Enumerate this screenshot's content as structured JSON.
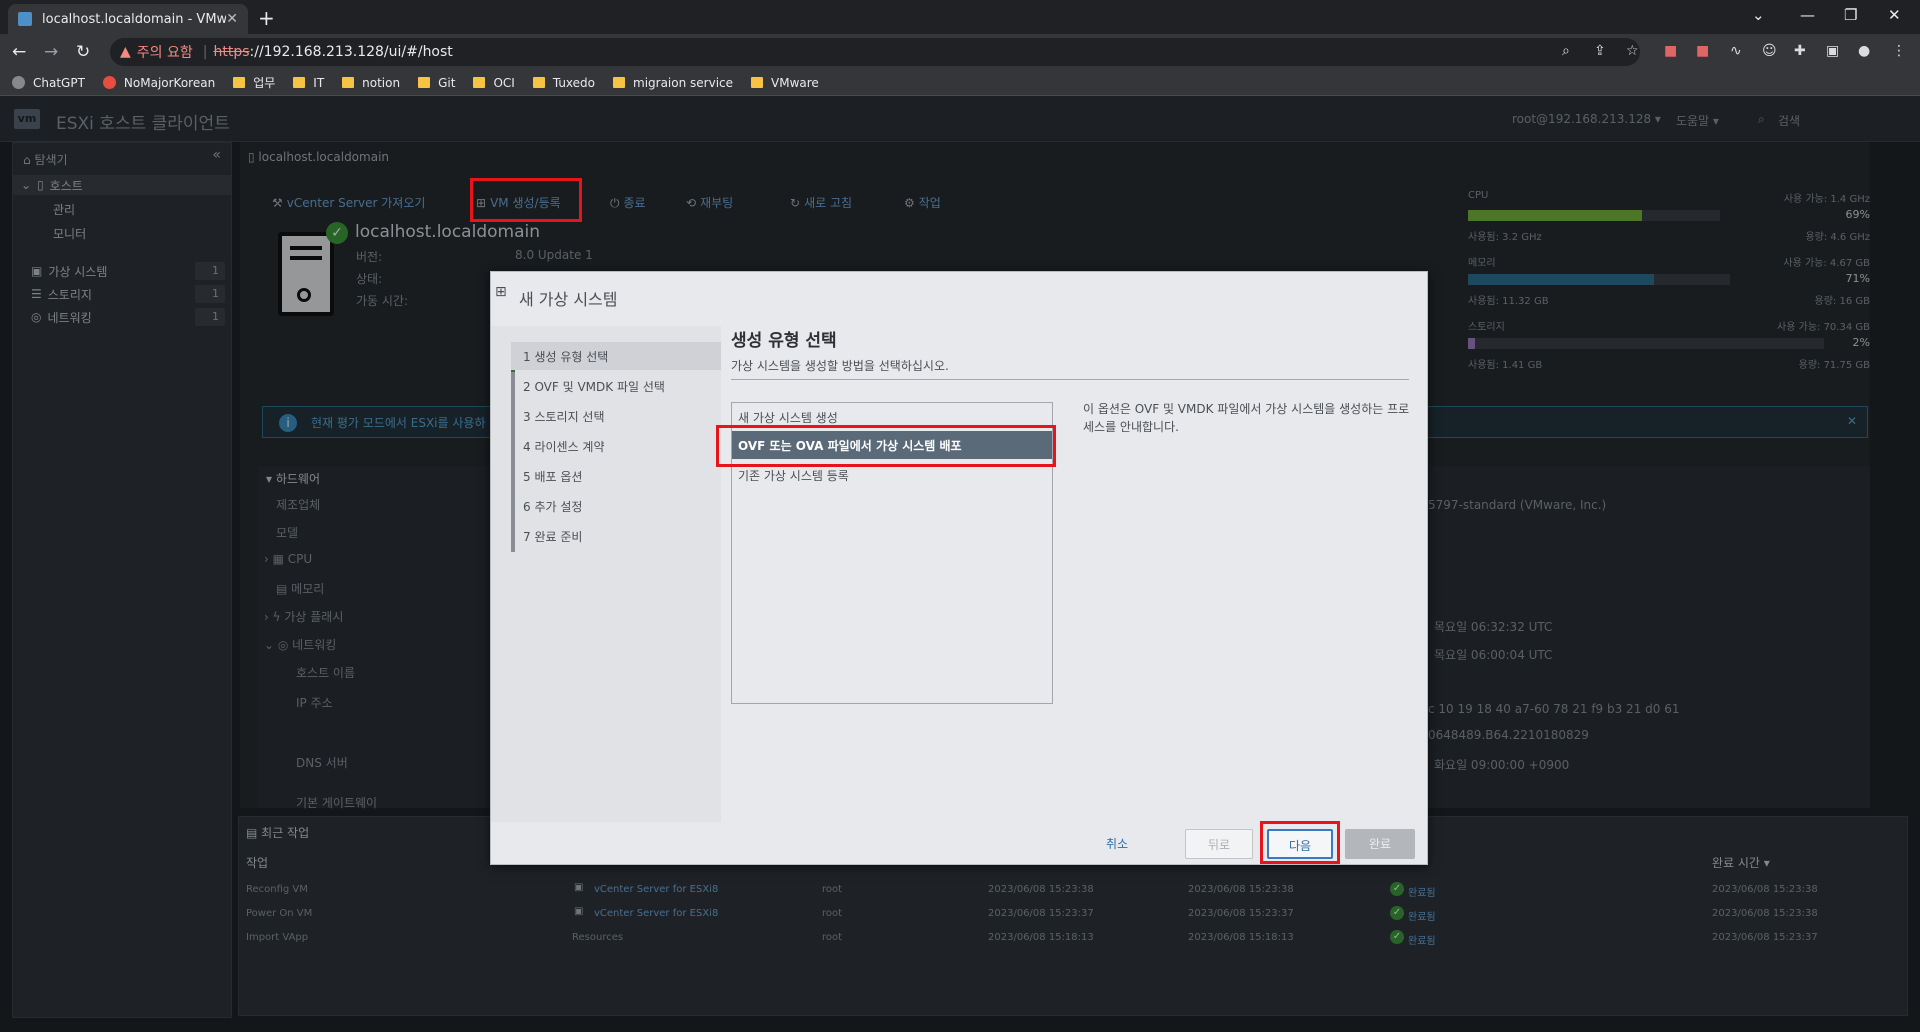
{
  "browser": {
    "tab_title": "localhost.localdomain - VMware",
    "security_label": "주의 요함",
    "url_https": "https",
    "url_rest": "://192.168.213.128/ui/#/host",
    "bookmarks": [
      "ChatGPT",
      "NoMajorKorean",
      "업무",
      "IT",
      "notion",
      "Git",
      "OCI",
      "Tuxedo",
      "migraion service",
      "VMware"
    ]
  },
  "esxi": {
    "logo": "vm",
    "title": "ESXi 호스트 클라이언트",
    "user": "root@192.168.213.128 ▾",
    "help": "도움말 ▾",
    "search": "검색"
  },
  "navigator": {
    "title": "탐색기",
    "host": "호스트",
    "manage": "관리",
    "monitor": "모니터",
    "vms": "가상 시스템",
    "vms_count": "1",
    "storage": "스토리지",
    "storage_count": "1",
    "network": "네트워킹",
    "network_count": "1"
  },
  "host": {
    "breadcrumb": "localhost.localdomain",
    "toolbar": {
      "vcenter": "vCenter Server 가져오기",
      "create_vm": "VM 생성/등록",
      "shutdown": "종료",
      "reboot": "재부팅",
      "refresh": "새로 고침",
      "actions": "작업"
    },
    "name": "localhost.localdomain",
    "version_label": "버전:",
    "version_value": "8.0 Update 1",
    "state_label": "상태:",
    "uptime_label": "가동 시간:",
    "resources": {
      "cpu": {
        "label": "CPU",
        "free": "사용 가능: 1.4 GHz",
        "pct": "69%",
        "pct_value": 69,
        "used": "사용됨: 3.2 GHz",
        "capacity": "용량: 4.6 GHz",
        "color": "#73b53d"
      },
      "memory": {
        "label": "메모리",
        "free": "사용 가능: 4.67 GB",
        "pct": "71%",
        "pct_value": 71,
        "used": "사용됨: 11.32 GB",
        "capacity": "용량: 16 GB",
        "color": "#2e6f8f"
      },
      "storage": {
        "label": "스토리지",
        "free": "사용 가능: 70.34 GB",
        "pct": "2%",
        "pct_value": 2,
        "used": "사용됨: 1.41 GB",
        "capacity": "용량: 71.75 GB",
        "color": "#a07cc5"
      }
    },
    "banner": "현재 평가 모드에서 ESXi를 사용하",
    "hardware": {
      "header": "하드웨어",
      "rows": [
        "제조업체",
        "모델",
        "CPU",
        "메모리",
        "가상 플래시",
        "네트워킹",
        "호스트 이름",
        "IP 주소",
        "DNS 서버",
        "기본 게이트웨이"
      ],
      "right_values": [
        "5797-standard (VMware, Inc.)",
        "목요일 06:32:32 UTC",
        "목요일 06:00:04 UTC",
        "c 10 19 18 40 a7-60 78 21 f9 b3 21 d0 61",
        "0648489.B64.2210180829",
        "화요일 09:00:00 +0900"
      ]
    }
  },
  "tasks": {
    "title": "최근 작업",
    "col_task": "작업",
    "col_done": "완료 시간 ▾",
    "rows": [
      {
        "task": "Reconfig VM",
        "target": "vCenter Server for ESXi8",
        "user": "root",
        "queued": "2023/06/08 15:23:38",
        "start": "2023/06/08 15:23:38",
        "result": "완료됨",
        "done": "2023/06/08 15:23:38"
      },
      {
        "task": "Power On VM",
        "target": "vCenter Server for ESXi8",
        "user": "root",
        "queued": "2023/06/08 15:23:37",
        "start": "2023/06/08 15:23:37",
        "result": "완료됨",
        "done": "2023/06/08 15:23:38"
      },
      {
        "task": "Import VApp",
        "target": "Resources",
        "user": "root",
        "queued": "2023/06/08 15:18:13",
        "start": "2023/06/08 15:18:13",
        "result": "완료됨",
        "done": "2023/06/08 15:23:37"
      }
    ]
  },
  "dialog": {
    "title": "새 가상 시스템",
    "steps": [
      "1  생성 유형 선택",
      "2  OVF 및 VMDK 파일 선택",
      "3  스토리지 선택",
      "4  라이센스 계약",
      "5  배포 옵션",
      "6  추가 설정",
      "7  완료 준비"
    ],
    "heading": "생성 유형 선택",
    "subtitle": "가상 시스템을 생성할 방법을 선택하십시오.",
    "options": [
      "새 가상 시스템 생성",
      "OVF 또는 OVA 파일에서 가상 시스템 배포",
      "기존 가상 시스템 등록"
    ],
    "description": "이 옵션은 OVF 및 VMDK 파일에서 가상 시스템을 생성하는 프로세스를 안내합니다.",
    "buttons": {
      "cancel": "취소",
      "back": "뒤로",
      "next": "다음",
      "finish": "완료"
    }
  }
}
